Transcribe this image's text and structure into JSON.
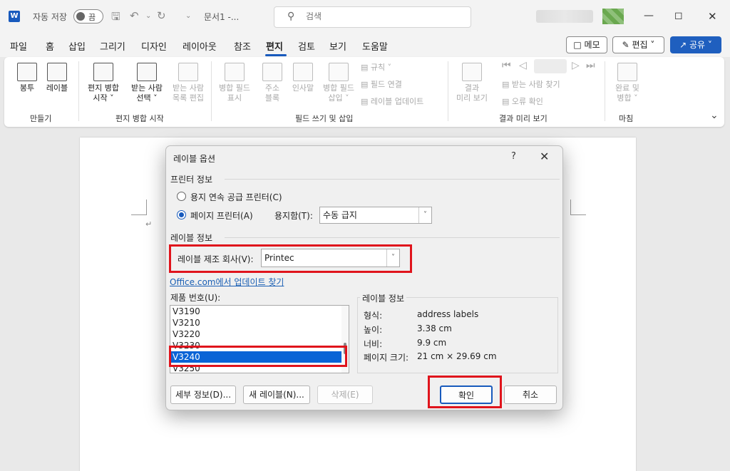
{
  "titlebar": {
    "autosave_label": "자동 저장",
    "autosave_state": "끔",
    "doc_title": "문서1  -...",
    "search_placeholder": "검색"
  },
  "menu": {
    "items": [
      "파일",
      "홈",
      "삽입",
      "그리기",
      "디자인",
      "레이아웃",
      "참조",
      "편지",
      "검토",
      "보기",
      "도움말"
    ],
    "active": "편지",
    "memo": "메모",
    "edit": "편집",
    "share": "공유"
  },
  "ribbon": {
    "envelope": "봉투",
    "labels": "레이블",
    "start_merge": [
      "편지 병합",
      "시작"
    ],
    "select_recipients": [
      "받는 사람",
      "선택"
    ],
    "edit_recipients": [
      "받는 사람",
      "목록 편집"
    ],
    "highlight_fields": [
      "병합 필드",
      "표시"
    ],
    "address_block": [
      "주소",
      "블록"
    ],
    "greeting": "인사말",
    "insert_field": [
      "병합 필드",
      "삽입"
    ],
    "rules": "규칙",
    "match_fields": "필드 연결",
    "update_labels": "레이블 업데이트",
    "preview_results": [
      "결과",
      "미리 보기"
    ],
    "find_recipient": "받는 사람 찾기",
    "check_errors": "오류 확인",
    "finish_merge": [
      "완료 및",
      "병합"
    ],
    "groups": {
      "create": "만들기",
      "start": "편지 병합 시작",
      "write": "필드 쓰기 및 삽입",
      "preview": "결과 미리 보기",
      "finish": "마침"
    }
  },
  "dialog": {
    "title": "레이블 옵션",
    "help": "?",
    "printer_info": "프린터 정보",
    "continuous": "용지 연속 공급 프린터(C)",
    "page_printer": "페이지 프린터(A)",
    "tray_label": "용지함(T):",
    "tray_value": "수동 급지",
    "label_info": "레이블 정보",
    "vendor_label": "레이블 제조 회사(V):",
    "vendor_value": "Printec",
    "update_link": "Office.com에서 업데이트 찾기",
    "product_label": "제품 번호(U):",
    "products": [
      "V3190",
      "V3210",
      "V3220",
      "V3230",
      "V3240",
      "V3250"
    ],
    "selected_product": "V3240",
    "info_title": "레이블 정보",
    "info": {
      "type_k": "형식:",
      "type_v": "address labels",
      "height_k": "높이:",
      "height_v": "3.38 cm",
      "width_k": "너비:",
      "width_v": "9.9 cm",
      "page_k": "페이지 크기:",
      "page_v": "21 cm × 29.69 cm"
    },
    "details_btn": "세부 정보(D)...",
    "new_label_btn": "새 레이블(N)...",
    "delete_btn": "삭제(E)",
    "ok_btn": "확인",
    "cancel_btn": "취소"
  },
  "colors": {
    "accent": "#185abd",
    "highlight": "#e0141c",
    "selection": "#0a64d6"
  }
}
